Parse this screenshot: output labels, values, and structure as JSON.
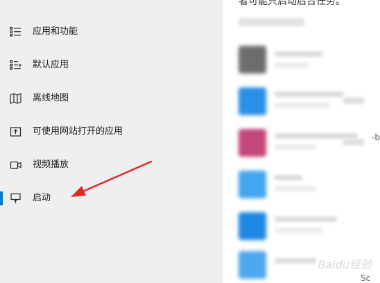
{
  "sidebar": {
    "items": [
      {
        "label": "应用和功能",
        "icon": "apps-list-icon"
      },
      {
        "label": "默认应用",
        "icon": "default-apps-icon"
      },
      {
        "label": "离线地图",
        "icon": "offline-map-icon"
      },
      {
        "label": "可使用网站打开的应用",
        "icon": "open-website-icon"
      },
      {
        "label": "视频播放",
        "icon": "video-icon"
      },
      {
        "label": "启动",
        "icon": "startup-icon"
      }
    ],
    "active_index": 5,
    "accent_color": "#0078d4"
  },
  "main": {
    "partial_top_text": "者可能只启动后台任务。",
    "edge_text": "-b",
    "bottom_edge_text": "Sc",
    "watermark": "Baidu经验"
  },
  "annotation": {
    "arrow_color": "#e02a2a"
  }
}
